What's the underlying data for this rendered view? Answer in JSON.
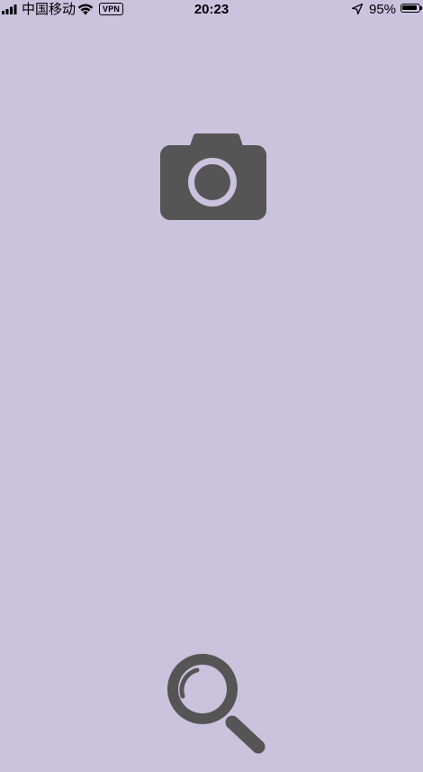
{
  "status_bar": {
    "carrier": "中国移动",
    "vpn": "VPN",
    "time": "20:23",
    "battery_percent": "95%",
    "battery_level": 0.95,
    "icons": [
      "signal-icon",
      "wifi-icon",
      "location-arrow-icon",
      "battery-icon"
    ]
  },
  "main": {
    "buttons": [
      {
        "icon": "camera-icon",
        "color": "#555555"
      },
      {
        "icon": "search-icon",
        "color": "#555555"
      }
    ]
  },
  "colors": {
    "background": "#c9c3de",
    "icon": "#555555",
    "camera_lens": "#c9c3de"
  }
}
